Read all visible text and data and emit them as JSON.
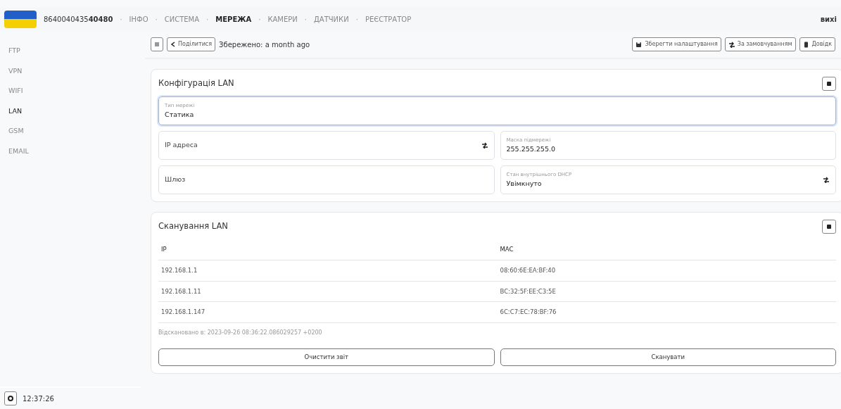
{
  "navbar": {
    "serial": "8640040435**40480**",
    "separator": "·",
    "items": [
      {
        "label": "ІНФО",
        "selected": false
      },
      {
        "label": "СИСТЕМА",
        "selected": false
      },
      {
        "label": "МЕРЕЖА",
        "selected": true
      },
      {
        "label": "КАМЕРИ",
        "selected": false
      },
      {
        "label": "ДАТЧИКИ",
        "selected": false
      },
      {
        "label": "РЕЄСТРАТОР",
        "selected": false
      }
    ],
    "logout": "вихі"
  },
  "sidebar": {
    "items": [
      {
        "label": "FTP",
        "selected": false
      },
      {
        "label": "VPN",
        "selected": false
      },
      {
        "label": "WIFI",
        "selected": false
      },
      {
        "label": "LAN",
        "selected": true
      },
      {
        "label": "GSM",
        "selected": false
      },
      {
        "label": "EMAIL",
        "selected": false
      }
    ],
    "clock": "12:37:26"
  },
  "toolbar": {
    "share": "Поділитися",
    "saved": "Збережено: a month ago",
    "buttons": [
      {
        "kind": "save",
        "label": "Зберегти налаштування"
      },
      {
        "kind": "reset",
        "label": "За замовчуванням"
      },
      {
        "kind": "help",
        "label": "Довідк"
      }
    ]
  },
  "config_card": {
    "title": "Конфігурація LAN",
    "fields": [
      {
        "label": "Тип мережі",
        "value": "Статика",
        "focused": true,
        "wide": true,
        "swap": false
      },
      {
        "label": "IP адреса",
        "focused": false,
        "wide": false,
        "swap": true
      },
      {
        "label": "Маска підмережі",
        "value": "255.255.255.0",
        "focused": false,
        "wide": false,
        "swap": false
      },
      {
        "label": "Шлюз",
        "focused": false,
        "wide": false,
        "swap": false
      },
      {
        "label": "Стан внутрішнього DHCP",
        "value": "Увімкнуто",
        "focused": false,
        "wide": false,
        "swap": true
      }
    ]
  },
  "scan_card": {
    "title": "Сканування LAN",
    "columns": [
      "IP",
      "MAC"
    ],
    "rows": [
      [
        "192.168.1.1",
        "08:60:6E:EA:BF:40"
      ],
      [
        "192.168.1.11",
        "BC:32:5F:EE:C3:5E"
      ],
      [
        "192.168.1.147",
        "6C:C7:EC:78:BF:76"
      ]
    ],
    "scanned_at": "Відскановано в: 2023-09-26 08:36:22.086029257 +0200",
    "buttons": [
      "Очистити звіт",
      "Сканувати"
    ]
  }
}
